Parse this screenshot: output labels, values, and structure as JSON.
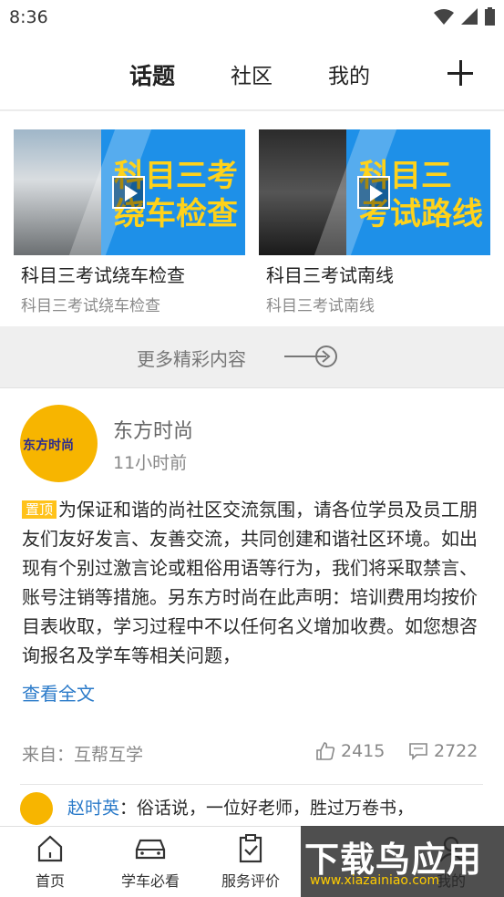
{
  "status_bar": {
    "time": "8:36"
  },
  "top_nav": {
    "tabs": [
      "话题",
      "社区",
      "我的"
    ],
    "active_tab": "话题"
  },
  "videos": [
    {
      "thumb_text": "科目三考\n绕车检查",
      "title": "科目三考试绕车检查",
      "subtitle": "科目三考试绕车检查"
    },
    {
      "thumb_text": "科目三\n考试路线",
      "title": "科目三考试南线",
      "subtitle": "科目三考试南线"
    }
  ],
  "more": {
    "label": "更多精彩内容"
  },
  "post": {
    "avatar_text": "东方时尚",
    "author": "东方时尚",
    "time": "11小时前",
    "pin_label": "置顶",
    "content": "为保证和谐的尚社区交流氛围，请各位学员及员工朋友们友好发言、友善交流，共同创建和谐社区环境。如出现有个别过激言论或粗俗用语等行为，我们将采取禁言、账号注销等措施。另东方时尚在此声明：培训费用均按价目表收取，学习过程中不以任何名义增加收费。如您想咨询报名及学车等相关问题，",
    "read_more": "查看全文",
    "source": "来自：互帮互学",
    "likes": "2415",
    "comments": "2722",
    "reply": {
      "name": "赵时英",
      "text": "：俗话说，一位好老师，胜过万卷书，"
    }
  },
  "tabbar": {
    "items": [
      {
        "label": "首页",
        "icon": "home-icon"
      },
      {
        "label": "学车必看",
        "icon": "car-icon"
      },
      {
        "label": "服务评价",
        "icon": "clipboard-check-icon"
      },
      {
        "label": "我的",
        "icon": "user-icon"
      }
    ]
  },
  "watermark": {
    "big": "下载鸟应用",
    "small": "www.xiazainiao.com"
  },
  "colors": {
    "accent": "#2a7ac9",
    "pin": "#ffc21a",
    "thumb_bg": "#1e90e8",
    "thumb_text": "#ffd21a"
  }
}
